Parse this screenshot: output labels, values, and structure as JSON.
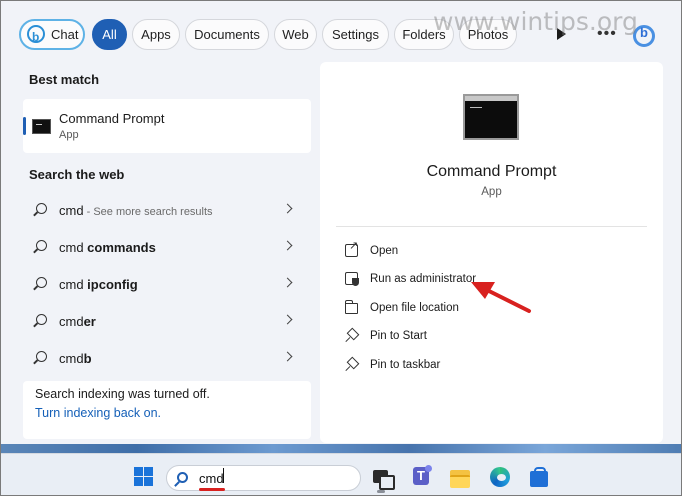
{
  "watermark": "www.wintips.org",
  "filters": {
    "chat": "Chat",
    "all": "All",
    "apps": "Apps",
    "documents": "Documents",
    "web": "Web",
    "settings": "Settings",
    "folders": "Folders",
    "photos": "Photos"
  },
  "left": {
    "best_match_title": "Best match",
    "best_match": {
      "name": "Command Prompt",
      "type": "App"
    },
    "search_web_title": "Search the web",
    "web_results": [
      {
        "prefix": "cmd",
        "bold": "",
        "sub": " - See more search results"
      },
      {
        "prefix": "cmd ",
        "bold": "commands",
        "sub": ""
      },
      {
        "prefix": "cmd ",
        "bold": "ipconfig",
        "sub": ""
      },
      {
        "prefix": "cmd",
        "bold": "er",
        "sub": ""
      },
      {
        "prefix": "cmd",
        "bold": "b",
        "sub": ""
      }
    ],
    "indexing_text": "Search indexing was turned off.",
    "indexing_link": "Turn indexing back on."
  },
  "right": {
    "app_title": "Command Prompt",
    "app_type": "App",
    "actions": [
      "Open",
      "Run as administrator",
      "Open file location",
      "Pin to Start",
      "Pin to taskbar"
    ]
  },
  "taskbar": {
    "search_value": "cmd"
  },
  "colors": {
    "accent": "#1f5fb4",
    "annotation": "#d8211f"
  }
}
